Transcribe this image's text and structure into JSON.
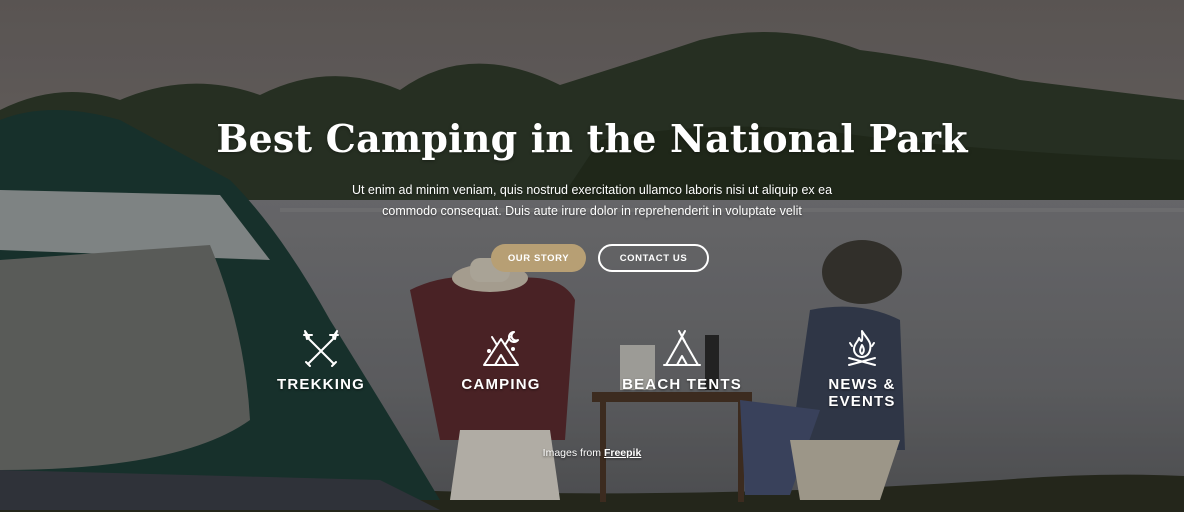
{
  "hero": {
    "title": "Best Camping in the National Park",
    "description_line1": "Ut enim ad minim veniam, quis nostrud exercitation ullamco laboris nisi ut aliquip ex ea",
    "description_line2": "commodo consequat. Duis aute irure dolor in reprehenderit in voluptate velit",
    "buttons": {
      "our_story": "OUR STORY",
      "contact_us": "CONTACT US"
    }
  },
  "features": [
    {
      "label": "TREKKING",
      "icon": "trekking-poles-icon"
    },
    {
      "label": "CAMPING",
      "icon": "tent-moon-icon"
    },
    {
      "label": "BEACH TENTS",
      "icon": "teepee-icon"
    },
    {
      "label_line1": "NEWS &",
      "label_line2": "EVENTS",
      "icon": "campfire-icon"
    }
  ],
  "credit": {
    "prefix": "Images from",
    "link": "Freepik"
  },
  "colors": {
    "accent": "#b79f74",
    "text": "#ffffff"
  }
}
